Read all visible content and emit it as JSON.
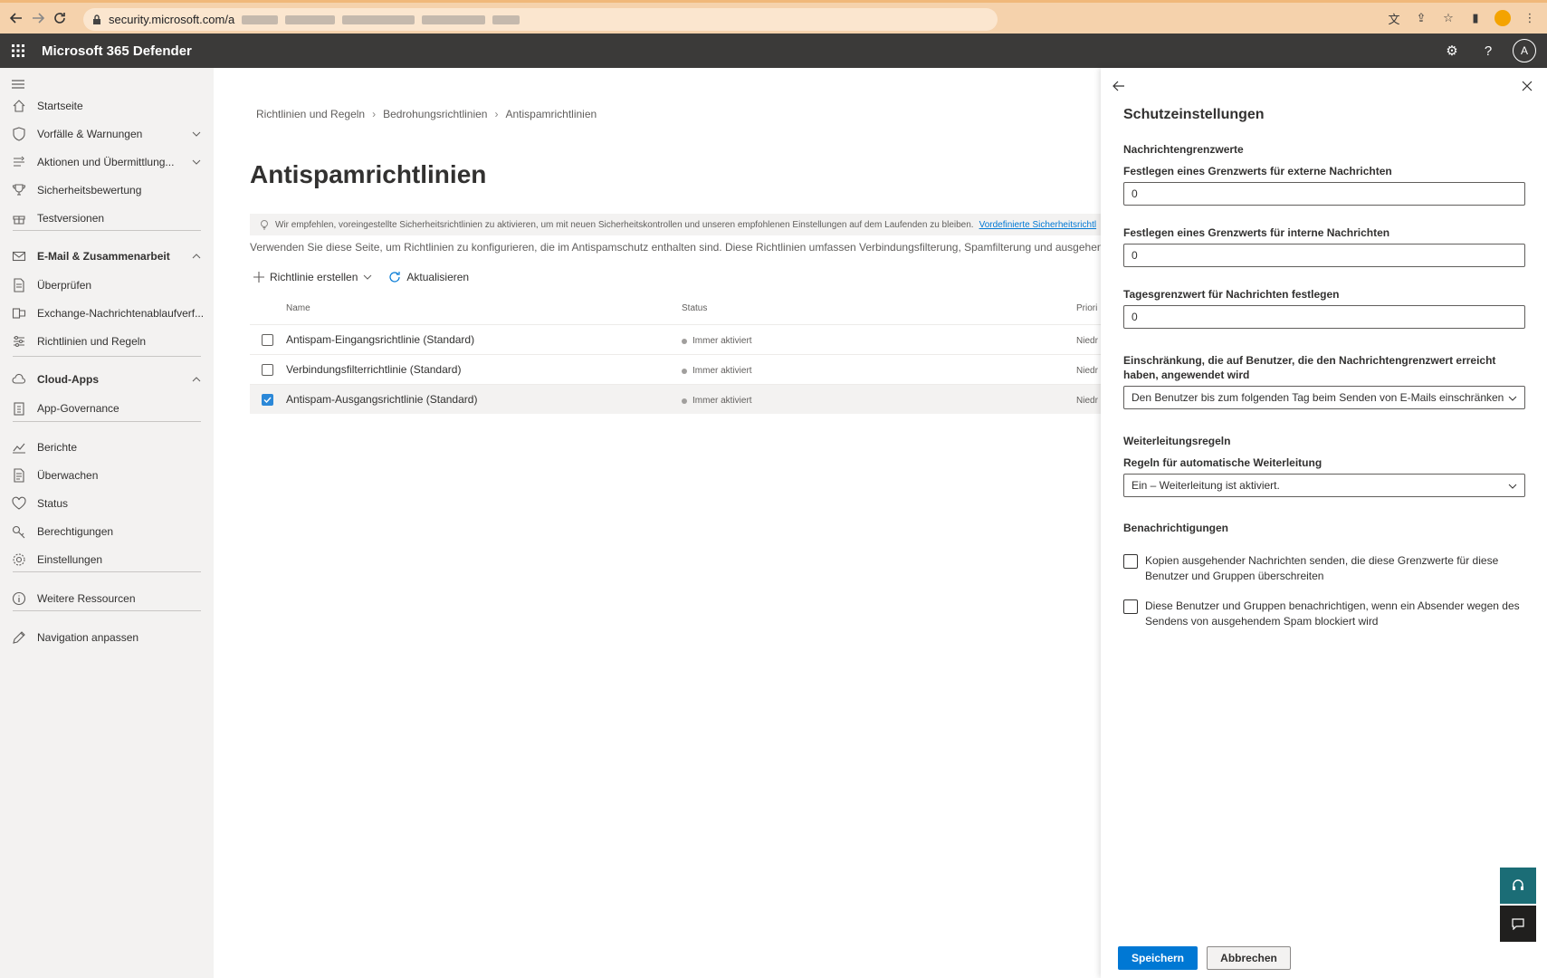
{
  "browser": {
    "url_prefix": "security.microsoft.com/a"
  },
  "app": {
    "title": "Microsoft 365 Defender",
    "avatar_letter": "A"
  },
  "sidebar": {
    "items": [
      {
        "label": "Startseite",
        "icon": "home-icon"
      },
      {
        "label": "Vorfälle & Warnungen",
        "icon": "shield-icon",
        "chevron": "down"
      },
      {
        "label": "Aktionen und Übermittlung...",
        "icon": "actions-icon",
        "chevron": "down"
      },
      {
        "label": "Sicherheitsbewertung",
        "icon": "trophy-icon"
      },
      {
        "label": "Testversionen",
        "icon": "gift-icon"
      },
      {
        "label": "E-Mail & Zusammenarbeit",
        "icon": "mail-icon",
        "chevron": "up",
        "section": true
      },
      {
        "label": "Überprüfen",
        "icon": "document-icon"
      },
      {
        "label": "Exchange-Nachrichtenablaufverf...",
        "icon": "exchange-icon"
      },
      {
        "label": "Richtlinien und Regeln",
        "icon": "settings-sliders-icon"
      },
      {
        "label": "Cloud-Apps",
        "icon": "cloud-icon",
        "chevron": "up",
        "section": true
      },
      {
        "label": "App-Governance",
        "icon": "clipboard-icon"
      },
      {
        "label": "Berichte",
        "icon": "chart-icon"
      },
      {
        "label": "Überwachen",
        "icon": "audit-icon"
      },
      {
        "label": "Status",
        "icon": "heart-icon"
      },
      {
        "label": "Berechtigungen",
        "icon": "key-icon"
      },
      {
        "label": "Einstellungen",
        "icon": "gear-icon"
      },
      {
        "label": "Weitere Ressourcen",
        "icon": "info-icon"
      },
      {
        "label": "Navigation anpassen",
        "icon": "pencil-icon"
      }
    ]
  },
  "main": {
    "breadcrumbs": [
      "Richtlinien und Regeln",
      "Bedrohungsrichtlinien",
      "Antispamrichtlinien"
    ],
    "title": "Antispamrichtlinien",
    "banner_text": "Wir empfehlen, voreingestellte Sicherheitsrichtlinien zu aktivieren, um mit neuen Sicherheitskontrollen und unseren empfohlenen Einstellungen auf dem Laufenden zu bleiben.",
    "banner_link": "Vordefinierte Sicherheitsrichtl",
    "description": "Verwenden Sie diese Seite, um Richtlinien zu konfigurieren, die im Antispamschutz enthalten sind. Diese Richtlinien umfassen Verbindungsfilterung, Spamfilterung und ausgehende Sp",
    "commands": {
      "create": "Richtlinie erstellen",
      "refresh": "Aktualisieren"
    },
    "table": {
      "headers": [
        "Name",
        "Status",
        "Priori"
      ],
      "rows": [
        {
          "name": "Antispam-Eingangsrichtlinie (Standard)",
          "status": "Immer aktiviert",
          "priority": "Niedr",
          "checked": false
        },
        {
          "name": "Verbindungsfilterrichtlinie (Standard)",
          "status": "Immer aktiviert",
          "priority": "Niedr",
          "checked": false
        },
        {
          "name": "Antispam-Ausgangsrichtlinie (Standard)",
          "status": "Immer aktiviert",
          "priority": "Niedr",
          "checked": true
        }
      ]
    }
  },
  "panel": {
    "title": "Schutzeinstellungen",
    "limits_heading": "Nachrichtengrenzwerte",
    "external_label": "Festlegen eines Grenzwerts für externe Nachrichten",
    "external_value": "0",
    "internal_label": "Festlegen eines Grenzwerts für interne Nachrichten",
    "internal_value": "0",
    "daily_label": "Tagesgrenzwert für Nachrichten festlegen",
    "daily_value": "0",
    "restriction_label": "Einschränkung, die auf Benutzer, die den Nachrichtengrenzwert erreicht haben, angewendet wird",
    "restriction_value": "Den Benutzer bis zum folgenden Tag beim Senden von E-Mails einschränken",
    "forwarding_heading": "Weiterleitungsregeln",
    "forwarding_label": "Regeln für automatische Weiterleitung",
    "forwarding_value": "Ein – Weiterleitung ist aktiviert.",
    "notifications_heading": "Benachrichtigungen",
    "check1": "Kopien ausgehender Nachrichten senden, die diese Grenzwerte für diese Benutzer und Gruppen überschreiten",
    "check2": "Diese Benutzer und Gruppen benachrichtigen, wenn ein Absender wegen des Sendens von ausgehendem Spam blockiert wird",
    "save": "Speichern",
    "cancel": "Abbrechen"
  },
  "colors": {
    "accent": "#0078d4",
    "header": "#3b3a39",
    "chrome": "#f5d2ac"
  }
}
